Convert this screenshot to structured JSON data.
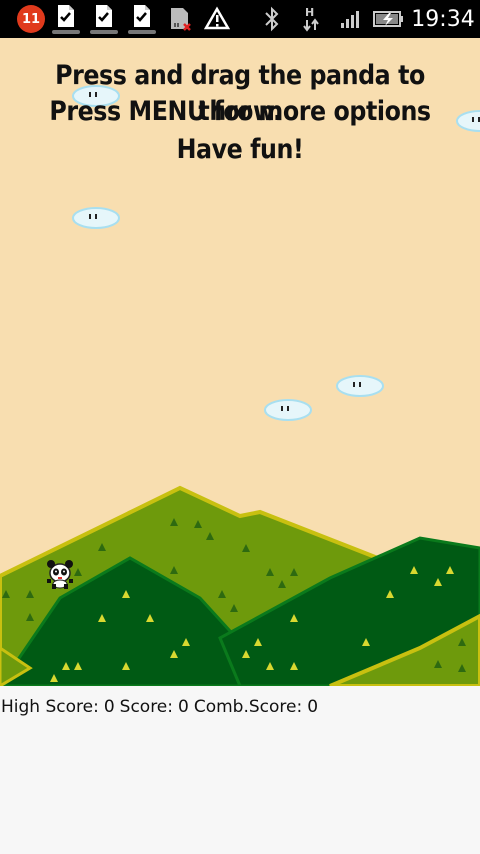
{
  "status_bar": {
    "notification_count": "11",
    "time": "19:34",
    "icons": [
      "notification-badge",
      "task-check-icon",
      "task-check-icon",
      "task-check-icon",
      "sd-card-error-icon",
      "warning-icon",
      "bluetooth-icon",
      "data-transfer-icon",
      "signal-icon",
      "battery-charging-icon"
    ]
  },
  "game": {
    "instructions": [
      "Press and drag the panda to throw.",
      "Press MENU for more options",
      "Have fun!"
    ],
    "colors": {
      "sky": "#f8deb0",
      "hill_light": "#6e9a0c",
      "hill_dark": "#005a14",
      "tree_light": "#d8d830",
      "tree_dark": "#2e6a10",
      "cloud": "#e6f6fa"
    }
  },
  "scores": {
    "high_label": "High Score:",
    "high_value": "0",
    "score_label": "Score:",
    "score_value": "0",
    "comb_label": "Comb.Score:",
    "comb_value": "0"
  }
}
